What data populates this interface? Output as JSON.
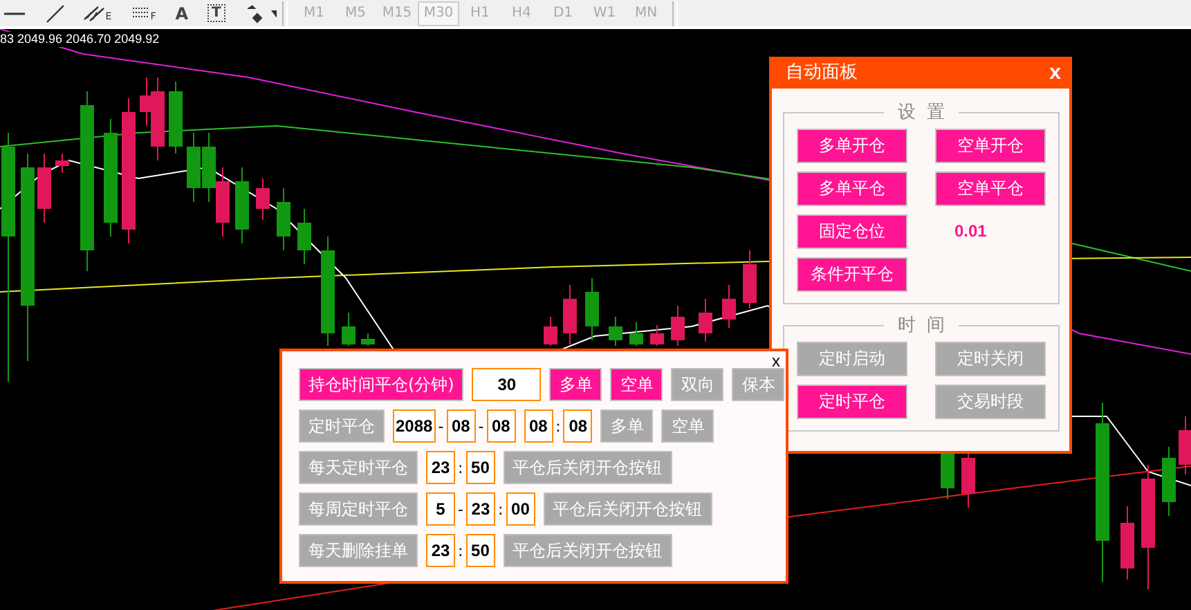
{
  "toolbar": {
    "tools": [
      {
        "kind": "hline"
      },
      {
        "kind": "trendline"
      },
      {
        "kind": "channel",
        "glyph": "E"
      },
      {
        "kind": "fibo",
        "glyph": "F"
      },
      {
        "kind": "letter",
        "glyph": "A"
      },
      {
        "kind": "label",
        "glyph": "T"
      },
      {
        "kind": "arrows"
      }
    ],
    "timeframes": [
      {
        "label": "M1",
        "selected": false
      },
      {
        "label": "M5",
        "selected": false
      },
      {
        "label": "M15",
        "selected": false
      },
      {
        "label": "M30",
        "selected": true
      },
      {
        "label": "H1",
        "selected": false
      },
      {
        "label": "H4",
        "selected": false
      },
      {
        "label": "D1",
        "selected": false
      },
      {
        "label": "W1",
        "selected": false
      },
      {
        "label": "MN",
        "selected": false
      }
    ]
  },
  "chart": {
    "price_readout": "83 2049.96 2046.70 2049.92"
  },
  "auto_panel": {
    "title": "自动面板",
    "close": "x",
    "settings": {
      "legend": "设  置",
      "items": [
        {
          "kind": "button",
          "label": "多单开仓",
          "on": true
        },
        {
          "kind": "button",
          "label": "空单开仓",
          "on": true
        },
        {
          "kind": "button",
          "label": "多单平仓",
          "on": true
        },
        {
          "kind": "button",
          "label": "空单平仓",
          "on": true
        },
        {
          "kind": "button",
          "label": "固定仓位",
          "on": true
        },
        {
          "kind": "value",
          "text": "0.01"
        },
        {
          "kind": "button",
          "label": "条件开平仓",
          "on": true
        }
      ]
    },
    "time": {
      "legend": "时  间",
      "items": [
        {
          "kind": "button",
          "label": "定时启动",
          "on": false
        },
        {
          "kind": "button",
          "label": "定时关闭",
          "on": false
        },
        {
          "kind": "button",
          "label": "定时平仓",
          "on": true
        },
        {
          "kind": "button",
          "label": "交易时段",
          "on": false
        }
      ]
    }
  },
  "order_panel": {
    "close": "x",
    "rows": [
      {
        "items": [
          {
            "kind": "button",
            "label": "持仓时间平仓(分钟)",
            "on": true
          },
          {
            "kind": "wide_field",
            "value": "30"
          },
          {
            "kind": "button",
            "label": "多单",
            "on": true
          },
          {
            "kind": "button",
            "label": "空单",
            "on": true
          },
          {
            "kind": "button",
            "label": "双向",
            "on": false
          },
          {
            "kind": "button",
            "label": "保本",
            "on": false
          }
        ]
      },
      {
        "items": [
          {
            "kind": "button",
            "label": "定时平仓",
            "on": false
          },
          {
            "kind": "field",
            "value": "2088"
          },
          {
            "kind": "sep",
            "text": "-"
          },
          {
            "kind": "field",
            "value": "08"
          },
          {
            "kind": "sep",
            "text": "-"
          },
          {
            "kind": "field",
            "value": "08"
          },
          {
            "kind": "field",
            "value": "08"
          },
          {
            "kind": "sep",
            "text": ":"
          },
          {
            "kind": "field",
            "value": "08"
          },
          {
            "kind": "button",
            "label": "多单",
            "on": false
          },
          {
            "kind": "button",
            "label": "空单",
            "on": false
          }
        ]
      },
      {
        "items": [
          {
            "kind": "button",
            "label": "每天定时平仓",
            "on": false
          },
          {
            "kind": "field",
            "value": "23"
          },
          {
            "kind": "sep",
            "text": ":"
          },
          {
            "kind": "field",
            "value": "50"
          },
          {
            "kind": "button",
            "label": "平仓后关闭开仓按钮",
            "on": false
          }
        ]
      },
      {
        "items": [
          {
            "kind": "button",
            "label": "每周定时平仓",
            "on": false
          },
          {
            "kind": "field",
            "value": "5"
          },
          {
            "kind": "sep",
            "text": "-"
          },
          {
            "kind": "field",
            "value": "23"
          },
          {
            "kind": "sep",
            "text": ":"
          },
          {
            "kind": "field",
            "value": "00"
          },
          {
            "kind": "button",
            "label": "平仓后关闭开仓按钮",
            "on": false
          }
        ]
      },
      {
        "items": [
          {
            "kind": "button",
            "label": "每天删除挂单",
            "on": false
          },
          {
            "kind": "field",
            "value": "23"
          },
          {
            "kind": "sep",
            "text": ":"
          },
          {
            "kind": "field",
            "value": "50"
          },
          {
            "kind": "button",
            "label": "平仓后关闭开仓按钮",
            "on": false
          }
        ]
      }
    ]
  }
}
